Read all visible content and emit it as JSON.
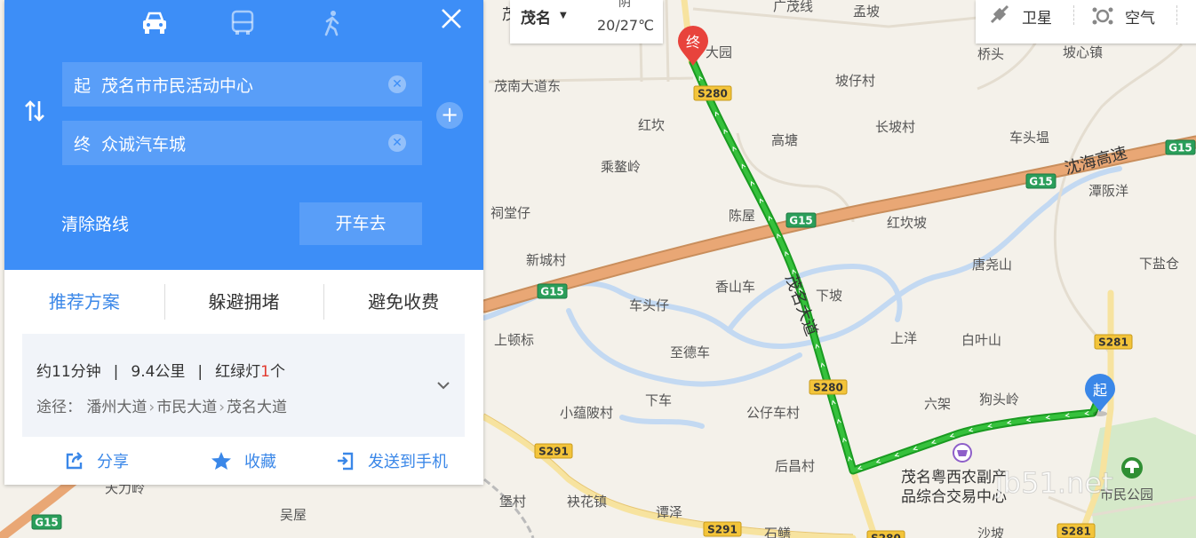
{
  "panel": {
    "modes": [
      {
        "name": "drive",
        "icon": "car-icon",
        "active": true
      },
      {
        "name": "transit",
        "icon": "bus-icon",
        "active": false
      },
      {
        "name": "walk",
        "icon": "walk-icon",
        "active": false
      }
    ],
    "start_tag": "起",
    "start_value": "茂名市市民活动中心",
    "end_tag": "终",
    "end_value": "众诚汽车城",
    "clear_route_label": "清除路线",
    "drive_button_label": "开车去",
    "tabs": [
      "推荐方案",
      "躲避拥堵",
      "避免收费"
    ],
    "summary": {
      "time": "约11分钟",
      "distance": "9.4公里",
      "lights_prefix": "红绿灯",
      "lights_count": "1",
      "lights_suffix": "个",
      "via_label": "途径：",
      "via_roads": [
        "潘州大道",
        "市民大道",
        "茂名大道"
      ]
    },
    "actions": {
      "share": "分享",
      "favorite": "收藏",
      "send_to_phone": "发送到手机"
    }
  },
  "topbar": {
    "city": "茂名",
    "weather_condition": "阴",
    "temperature": "20/27℃",
    "tools": [
      {
        "label": "卫星",
        "icon": "satellite-icon"
      },
      {
        "label": "空气",
        "icon": "air-quality-icon"
      }
    ]
  },
  "map": {
    "places": [
      "广茂线",
      "孟坡",
      "大园",
      "桥头",
      "坡心镇",
      "茂南大道东",
      "坡仔村",
      "红坎",
      "高塘",
      "长坡村",
      "车头塭",
      "乘鳌岭",
      "沈海高速",
      "潭阪洋",
      "祠堂仔",
      "陈屋",
      "红坎坡",
      "新城村",
      "唐尧山",
      "下盐仓",
      "香山车",
      "茂名大道",
      "下坡",
      "车头仔",
      "上顿标",
      "上洋",
      "白叶山",
      "至德车",
      "下车",
      "六架",
      "狗头岭",
      "小蕴陂村",
      "公仔车村",
      "后昌村",
      "茂名粤西农副产品综合交易中心",
      "市民公园",
      "堡村",
      "袂花镇",
      "谭泽",
      "天力岭",
      "吴屋",
      "沙坡",
      "石鳝",
      "茂"
    ],
    "shields": [
      "S280",
      "G15",
      "G15",
      "G15",
      "G15",
      "S280",
      "S281",
      "S291",
      "S291",
      "S280",
      "S281",
      "G15"
    ],
    "markers": {
      "start": "起",
      "end": "终"
    },
    "watermark": "jb51.net"
  }
}
